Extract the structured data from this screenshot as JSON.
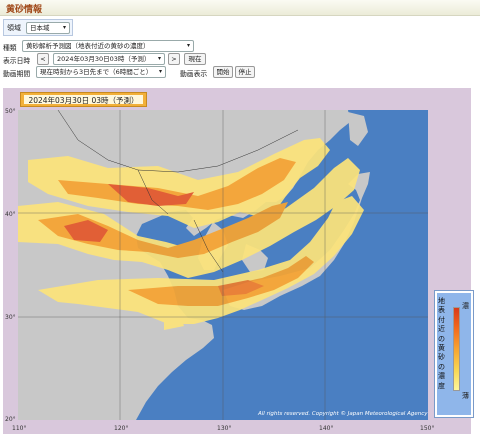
{
  "app": {
    "title": "黄砂情報"
  },
  "region": {
    "label": "領域",
    "value": "日本域"
  },
  "controls": {
    "type_label": "種類",
    "type_value": "黄砂解析予測図（地表付近の黄砂の濃度）",
    "datetime_label": "表示日時",
    "prev": "<",
    "datetime_value": "2024年03月30日03時（予測）",
    "next": ">",
    "now": "現在",
    "period_label": "動画期間",
    "period_value": "現在時刻から3日先まで（6時間ごと）",
    "anim_label": "動画表示",
    "start": "開始",
    "stop": "停止"
  },
  "map": {
    "time_label": "2024年03月30日 03時（予測）",
    "lat_labels": [
      "50°",
      "40°",
      "30°",
      "20°"
    ],
    "lon_labels": [
      "110°",
      "120°",
      "130°",
      "140°",
      "150°"
    ],
    "copyright": "All rights reserved. Copyright © Japan Meteorological Agency"
  },
  "legend": {
    "title": "地表付近の黄砂の濃度",
    "high": "濃",
    "low": "薄"
  },
  "colors": {
    "sea": "#4a7fc2",
    "land": "#c8c8c8",
    "dust_low": "#fdf79a",
    "dust_mid": "#f7a431",
    "dust_high": "#d83a1a"
  }
}
